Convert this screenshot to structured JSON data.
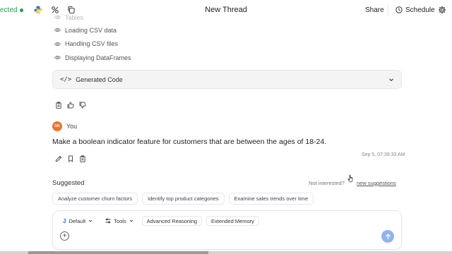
{
  "header": {
    "connection_status": "ected",
    "title": "New Thread",
    "share_label": "Share",
    "schedule_label": "Schedule"
  },
  "steps": {
    "faded_item": "Tables",
    "items": [
      "Loading CSV data",
      "Handling CSV files",
      "Displaying DataFrames"
    ]
  },
  "generated_code": {
    "icon_text": "</>",
    "label": "Generated Code"
  },
  "user_message": {
    "avatar_initials": "OK",
    "author": "You",
    "text": "Make a boolean indicator feature for customers that are between the ages of 18-24.",
    "timestamp": "Sep 5, 07:39:33 AM"
  },
  "suggested": {
    "label": "Suggested",
    "not_interested": "Not interested?",
    "new_suggestions": "new suggestions",
    "chips": [
      "Analyze customer churn factors",
      "Identify top product categories",
      "Examine sales trends over time"
    ]
  },
  "composer": {
    "model_glyph": "J",
    "model_label": "Default",
    "tools_label": "Tools",
    "advanced_reasoning": "Advanced Reasoning",
    "extended_memory": "Extended Memory",
    "plus_glyph": "+"
  },
  "colors": {
    "accent_blue": "#2563eb",
    "send_button": "#8fb4ee",
    "status_green": "#16a34a",
    "avatar": "#e8762c"
  },
  "icons": [
    "python-icon",
    "settings-pair-icon",
    "copy-icon",
    "clock-icon",
    "gear-icon",
    "eye-icon",
    "chevron-down-icon",
    "clipboard-icon",
    "thumbs-up-icon",
    "thumbs-down-icon",
    "pencil-icon",
    "bookmark-icon",
    "arrow-up-icon",
    "plus-icon"
  ]
}
